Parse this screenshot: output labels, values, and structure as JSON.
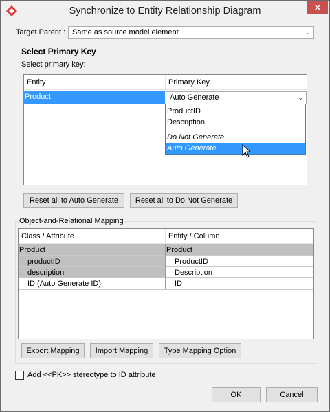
{
  "window": {
    "title": "Synchronize to Entity Relationship Diagram",
    "close_glyph": "✕"
  },
  "target_parent": {
    "label": "Target Parent :",
    "value": "Same as source model element"
  },
  "primary_key": {
    "section_title": "Select Primary Key",
    "sublabel": "Select primary key:",
    "columns": [
      "Entity",
      "Primary Key"
    ],
    "row": {
      "entity": "Product",
      "primary_key": "Auto Generate"
    },
    "dropdown_options": [
      "ProductID",
      "Description",
      "Do Not Generate",
      "Auto Generate"
    ],
    "highlighted_option": "Auto Generate",
    "reset_auto_label": "Reset all to Auto Generate",
    "reset_none_label": "Reset all to Do Not Generate"
  },
  "mapping": {
    "group_label": "Object-and-Relational Mapping",
    "columns": [
      "Class / Attribute",
      "Entity / Column"
    ],
    "rows": [
      {
        "left": "Product",
        "right": "Product"
      },
      {
        "left": "productID",
        "right": "ProductID"
      },
      {
        "left": "description",
        "right": "Description"
      },
      {
        "left": "ID (Auto Generate ID)",
        "right": "ID"
      }
    ],
    "export_label": "Export Mapping",
    "import_label": "Import Mapping",
    "type_option_label": "Type Mapping Option"
  },
  "pk_stereotype": {
    "label": "Add <<PK>> stereotype to ID attribute",
    "checked": false
  },
  "footer": {
    "ok_label": "OK",
    "cancel_label": "Cancel"
  },
  "colors": {
    "selection": "#3399ff",
    "window_bg": "#f0f0f0",
    "close_button": "#c75050"
  }
}
